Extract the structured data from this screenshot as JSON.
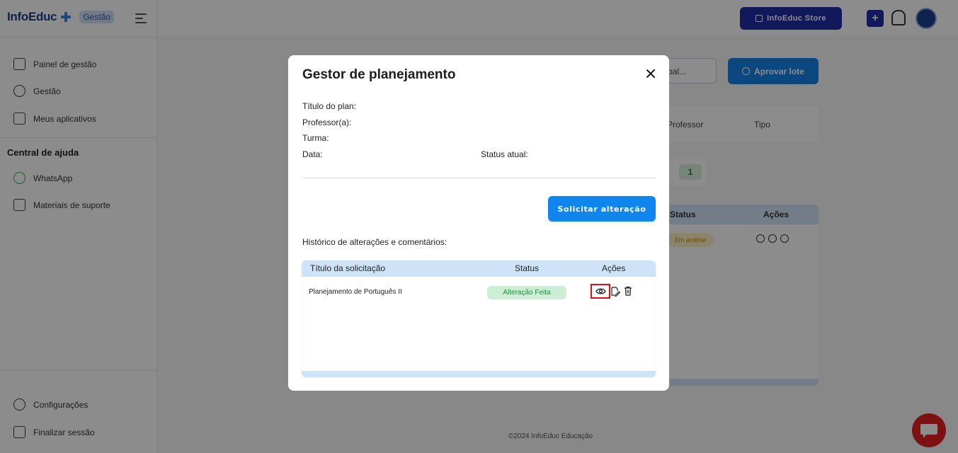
{
  "app": {
    "logo_text": "InfoEduc",
    "badge": "Gestão",
    "store_button": "InfoEduc Store",
    "plus_label": "+"
  },
  "sidebar": {
    "items": [
      {
        "label": "Painel de gestão",
        "icon": "home-icon"
      },
      {
        "label": "Gestão",
        "icon": "graduation-cap-icon"
      },
      {
        "label": "Meus aplicativos",
        "icon": "apps-icon"
      }
    ],
    "help_title": "Central de ajuda",
    "help_items": [
      {
        "label": "WhatsApp",
        "icon": "whatsapp-icon"
      },
      {
        "label": "Materiais de suporte",
        "icon": "book-icon"
      }
    ],
    "bottom_items": [
      {
        "label": "Configurações",
        "icon": "gear-icon"
      },
      {
        "label": "Finalizar sessão",
        "icon": "logout-icon"
      }
    ]
  },
  "background": {
    "select_value": "pal...",
    "approve_button": "Aprovar lote",
    "filter_professor": "Professor",
    "filter_tipo": "Tipo",
    "count": "1",
    "table_headers": [
      "Status",
      "Ações"
    ],
    "row_status": "Em análise",
    "footer": "©2024 InfoEduc Educação"
  },
  "modal": {
    "title": "Gestor de planejamento",
    "fields": {
      "titulo": "Título do plan:",
      "professor": "Professor(a):",
      "turma": "Turma:",
      "data": "Data:",
      "status_atual": "Status atual:"
    },
    "request_button": "Solicitar alteração",
    "history_title": "Histórico de alterações e comentários:",
    "table": {
      "headers": [
        "Título da solicitação",
        "Status",
        "Ações"
      ],
      "rows": [
        {
          "title": "Planejamento de Português II",
          "status": "Alteração Feita"
        }
      ]
    }
  },
  "colors": {
    "primary": "#1185ee",
    "navy": "#1f2fa8",
    "table_header": "#cfe3f8",
    "success_bg": "#cdeed5",
    "success_text": "#1f8d3c",
    "highlight": "#e01010"
  }
}
